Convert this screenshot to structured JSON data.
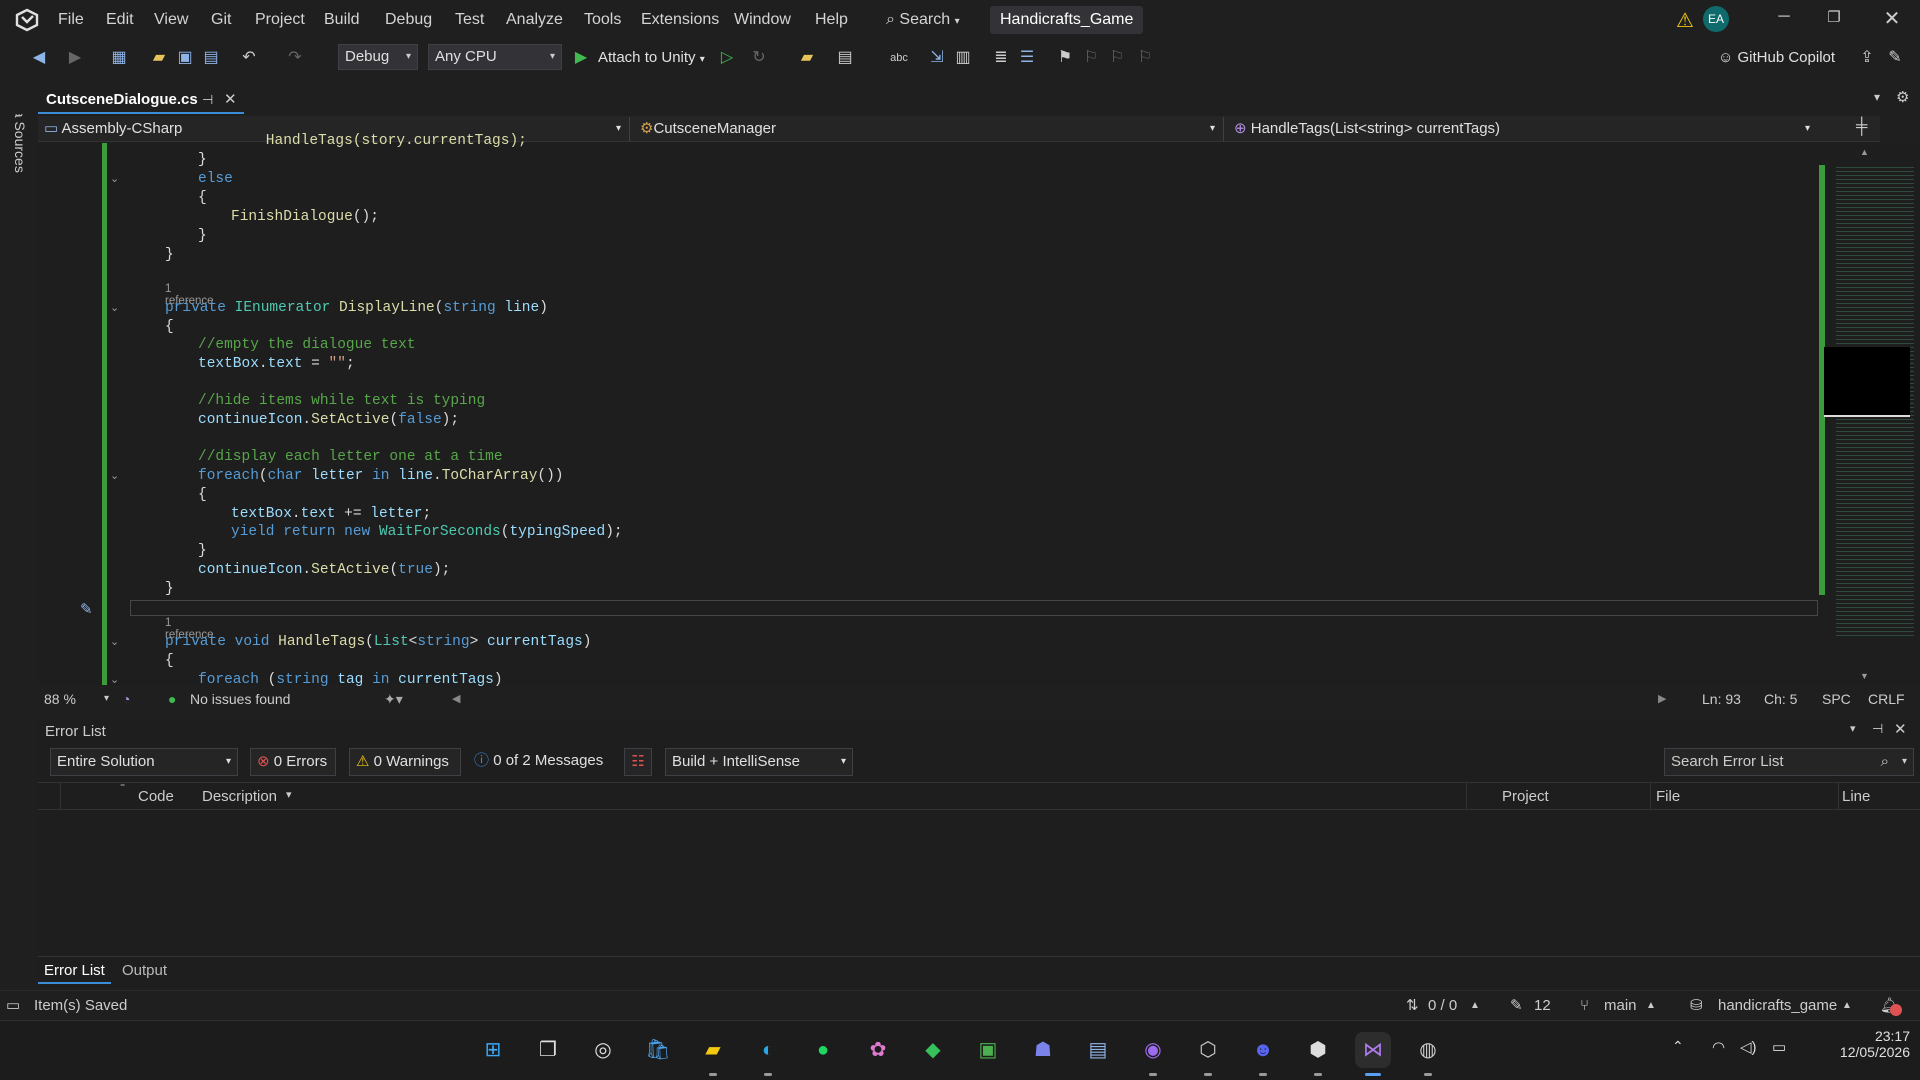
{
  "titlebar": {
    "menus": [
      "File",
      "Edit",
      "View",
      "Git",
      "Project",
      "Build",
      "Debug",
      "Test",
      "Analyze",
      "Tools",
      "Extensions",
      "Window",
      "Help"
    ],
    "search_label": "Search",
    "solution_name": "Handicrafts_Game",
    "user_initials": "EA"
  },
  "toolbar": {
    "config": "Debug",
    "platform": "Any CPU",
    "attach_label": "Attach to Unity",
    "copilot_label": "GitHub Copilot"
  },
  "sidebar": {
    "data_sources_label": "Data Sources"
  },
  "tabs": [
    {
      "label": "CutsceneDialogue.cs",
      "active": true
    }
  ],
  "navbar": {
    "project": "Assembly-CSharp",
    "type": "CutsceneManager",
    "member": "HandleTags(List<string> currentTags)"
  },
  "code": {
    "l0": "    HandleTags(story.currentTags);",
    "lens1": "1 reference",
    "lens2": "1 reference"
  },
  "editor_status": {
    "zoom": "88 %",
    "issues": "No issues found",
    "line": "Ln: 93",
    "col": "Ch: 5",
    "spacing": "SPC",
    "eol": "CRLF"
  },
  "error_list": {
    "title": "Error List",
    "scope": "Entire Solution",
    "errors": "0 Errors",
    "warnings": "0 Warnings",
    "messages": "0 of 2 Messages",
    "build_filter": "Build + IntelliSense",
    "search_placeholder": "Search Error List",
    "columns": {
      "code": "Code",
      "description": "Description",
      "project": "Project",
      "file": "File",
      "line": "Line"
    },
    "bottom_tabs": [
      "Error List",
      "Output"
    ]
  },
  "statusbar": {
    "message": "Item(s) Saved",
    "changes": "0 / 0",
    "edits": "12",
    "branch": "main",
    "repo": "handicrafts_game"
  },
  "taskbar": {
    "time": "23:17",
    "date": "12/05/2026"
  },
  "colors": {
    "accent": "#3c8cd8",
    "gutter_changed": "#3c9c3c",
    "error": "#e05252",
    "warning": "#f2c811"
  }
}
